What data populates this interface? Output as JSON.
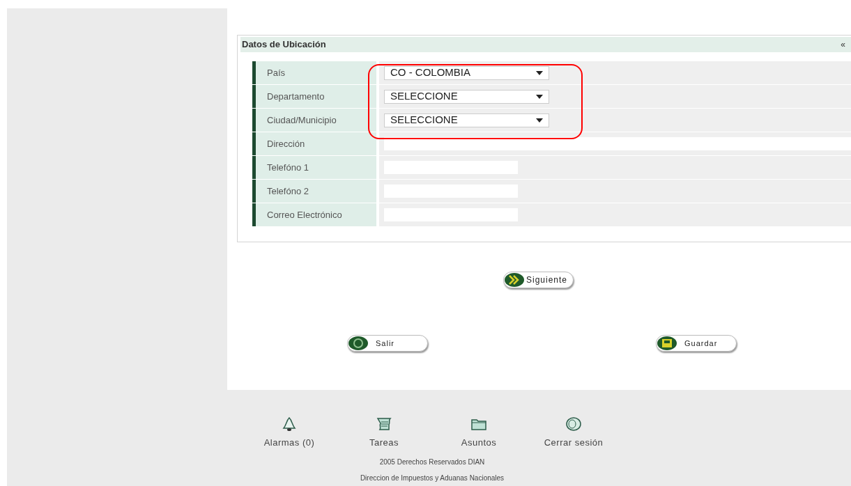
{
  "section": {
    "title": "Datos de Ubicación",
    "collapse": "«"
  },
  "fields": [
    {
      "label": "País",
      "kind": "select",
      "value": "CO - COLOMBIA"
    },
    {
      "label": "Departamento",
      "kind": "select",
      "value": "SELECCIONE"
    },
    {
      "label": "Ciudad/Municipio",
      "kind": "select",
      "value": "SELECCIONE"
    },
    {
      "label": "Dirección",
      "kind": "long_text"
    },
    {
      "label": "Telefóno 1",
      "kind": "text"
    },
    {
      "label": "Telefóno 2",
      "kind": "text"
    },
    {
      "label": "Correo Electrónico",
      "kind": "text"
    }
  ],
  "next_button": "Siguiente",
  "actions": [
    {
      "label": "Salir",
      "kind": "exit"
    },
    {
      "label": "Guardar",
      "kind": "save"
    }
  ],
  "footer_links": [
    {
      "label": "Alarmas (0)",
      "kind": "bell"
    },
    {
      "label": "Tareas",
      "kind": "tasks"
    },
    {
      "label": "Asuntos",
      "kind": "folder"
    },
    {
      "label": "Cerrar sesión",
      "kind": "logout"
    }
  ],
  "copyright": [
    "2005 Derechos Reservados DIAN",
    "Direccion de Impuestos y Aduanas Nacionales"
  ]
}
